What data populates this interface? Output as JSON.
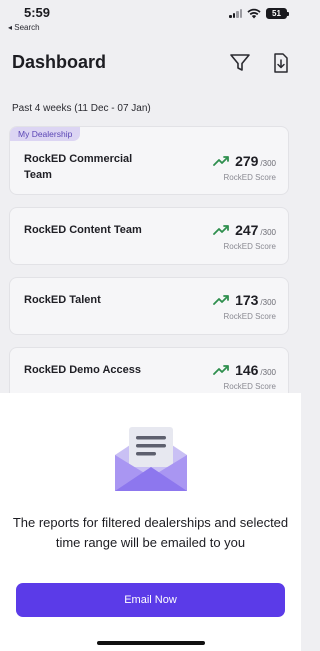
{
  "status_bar": {
    "time": "5:59",
    "back_label": "◂ Search",
    "battery": "51"
  },
  "header": {
    "title": "Dashboard",
    "filter_icon": "filter-icon",
    "download_icon": "download-icon"
  },
  "date_range": "Past 4 weeks (11 Dec - 07 Jan)",
  "cards": [
    {
      "badge": "My Dealership",
      "team": "RockED Commercial Team",
      "score": "279",
      "max": "/300",
      "score_label": "RockED Score"
    },
    {
      "team": "RockED Content Team",
      "score": "247",
      "max": "/300",
      "score_label": "RockED Score"
    },
    {
      "team": "RockED Talent",
      "score": "173",
      "max": "/300",
      "score_label": "RockED Score"
    },
    {
      "team": "RockED Demo Access",
      "score": "146",
      "max": "/300",
      "score_label": "RockED Score"
    }
  ],
  "sheet": {
    "icon": "envelope-icon",
    "message": "The reports for filtered dealerships and selected time range will be emailed to you",
    "button_label": "Email Now"
  },
  "colors": {
    "accent": "#5b3be8",
    "trend": "#2f8f4e",
    "badge_bg": "#dcd5f3",
    "badge_text": "#5a45b5"
  }
}
